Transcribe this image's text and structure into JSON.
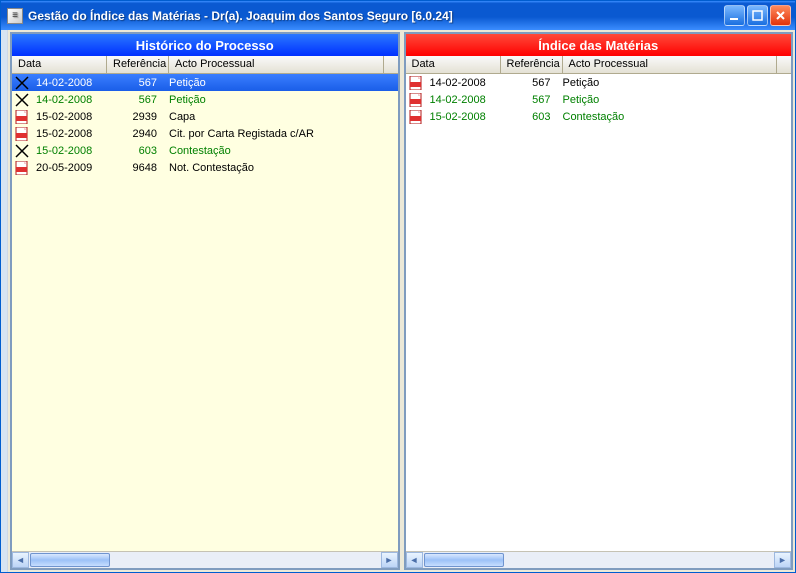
{
  "window": {
    "title": "Gestão do Índice das Matérias - Dr(a). Joaquim dos Santos Seguro [6.0.24]"
  },
  "columns": {
    "data": "Data",
    "ref": "Referência",
    "act": "Acto Processual"
  },
  "panels": {
    "left": {
      "title": "Histórico do Processo",
      "rows": [
        {
          "icon": "x",
          "data": "14-02-2008",
          "ref": "567",
          "act": "Petição",
          "green": true,
          "selected": true
        },
        {
          "icon": "x",
          "data": "14-02-2008",
          "ref": "567",
          "act": "Petição",
          "green": true
        },
        {
          "icon": "pdf",
          "data": "15-02-2008",
          "ref": "2939",
          "act": "Capa"
        },
        {
          "icon": "pdf",
          "data": "15-02-2008",
          "ref": "2940",
          "act": "Cit. por Carta Registada c/AR"
        },
        {
          "icon": "x",
          "data": "15-02-2008",
          "ref": "603",
          "act": "Contestação",
          "green": true
        },
        {
          "icon": "pdf",
          "data": "20-05-2009",
          "ref": "9648",
          "act": "Not. Contestação"
        }
      ]
    },
    "right": {
      "title": "Índice das Matérias",
      "rows": [
        {
          "icon": "pdf",
          "data": "14-02-2008",
          "ref": "567",
          "act": "Petição"
        },
        {
          "icon": "pdf",
          "data": "14-02-2008",
          "ref": "567",
          "act": "Petição",
          "green": true
        },
        {
          "icon": "pdf",
          "data": "15-02-2008",
          "ref": "603",
          "act": "Contestação",
          "green": true
        }
      ]
    }
  }
}
